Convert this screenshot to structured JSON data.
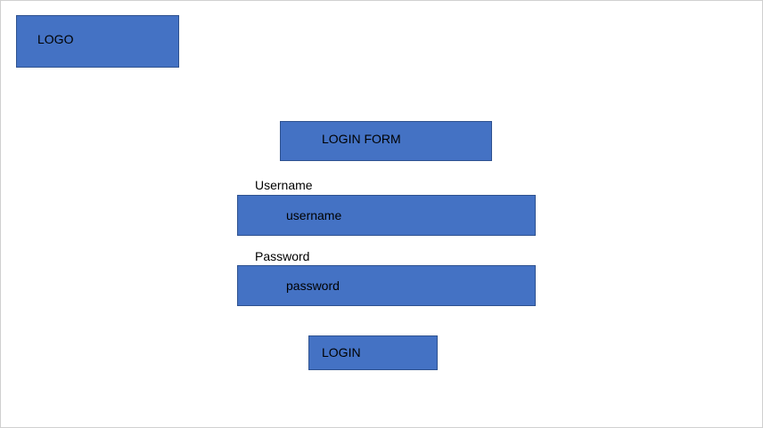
{
  "logo": {
    "label": "LOGO"
  },
  "form": {
    "title": "LOGIN FORM",
    "username_label": "Username",
    "username_value": "username",
    "password_label": "Password",
    "password_value": "password",
    "login_label": "LOGIN"
  },
  "colors": {
    "box_fill": "#4472c4",
    "box_border": "#2f528f",
    "background": "#ffffff"
  }
}
